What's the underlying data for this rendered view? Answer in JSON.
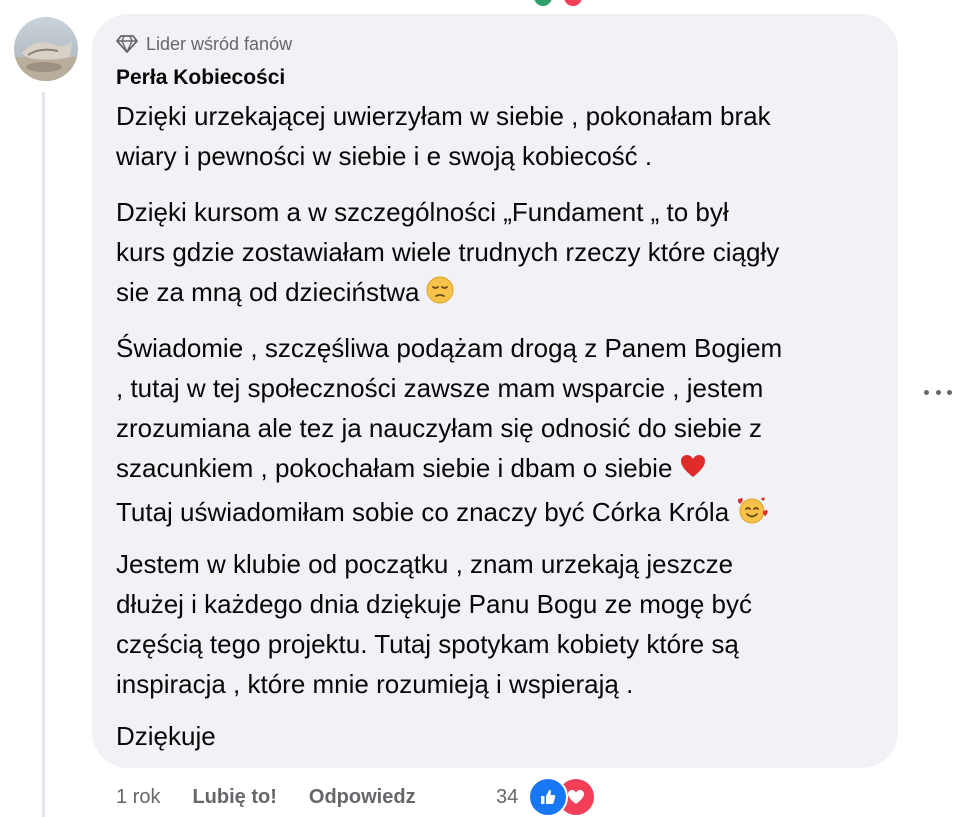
{
  "comment": {
    "badge": "Lider wśród fanów",
    "author": "Perła Kobiecości",
    "paragraphs": {
      "p1": [
        "Dzięki urzekającej uwierzyłam w siebie , pokonałam brak",
        "wiary i pewności w siebie i e swoją kobiecość ."
      ],
      "p2": [
        "Dzięki kursom a w szczególności „Fundament „ to był",
        "kurs gdzie zostawiałam wiele trudnych rzeczy które ciągły",
        "sie za mną od dzieciństwa"
      ],
      "p3": [
        "Świadomie , szczęśliwa podążam drogą z Panem Bogiem",
        ", tutaj w tej społeczności zawsze mam wsparcie , jestem",
        "zrozumiana ale tez ja nauczyłam się odnosić do siebie z",
        "szacunkiem , pokochałam siebie i dbam o siebie",
        "Tutaj uświadomiłam sobie co znaczy być Córka Króla"
      ],
      "p4": [
        "Jestem w klubie od początku , znam urzekają jeszcze",
        "dłużej i każdego dnia dziękuje Panu Bogu ze mogę być",
        "częścią tego projektu. Tutaj spotykam kobiety które są",
        "inspiracja , które mnie rozumieją i wspierają ."
      ],
      "p5": [
        "Dziękuje"
      ]
    },
    "emojis": {
      "pensive": "pensive-face-icon",
      "heart": "red-heart-icon",
      "hearts_face": "smiling-face-with-hearts-icon"
    }
  },
  "actions": {
    "time": "1 rok",
    "like": "Lubię to!",
    "reply": "Odpowiedz",
    "reaction_count": "34"
  },
  "colors": {
    "bubble": "#f0f2f5",
    "secondary_text": "#65676b",
    "like_blue": "#1877f2",
    "love_red": "#f33e58"
  }
}
